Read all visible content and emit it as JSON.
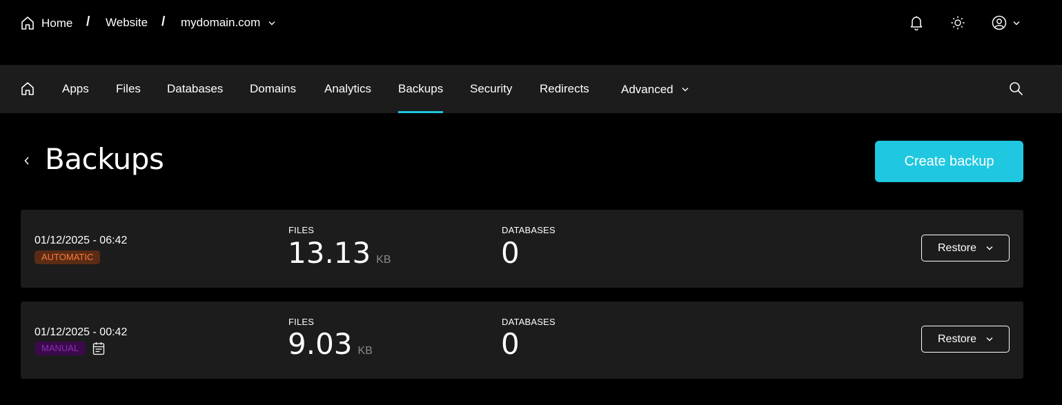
{
  "breadcrumb": {
    "home": "Home",
    "separator": "/",
    "website": "Website",
    "domain": "mydomain.com"
  },
  "top_icons": [
    "bell-icon",
    "sun-icon",
    "account-icon"
  ],
  "nav": {
    "items": [
      {
        "label": "Apps"
      },
      {
        "label": "Files"
      },
      {
        "label": "Databases"
      },
      {
        "label": "Domains"
      },
      {
        "label": "Analytics"
      },
      {
        "label": "Backups",
        "active": true
      },
      {
        "label": "Security"
      },
      {
        "label": "Redirects"
      },
      {
        "label": "Advanced"
      }
    ]
  },
  "page": {
    "title": "Backups",
    "create_button": "Create backup"
  },
  "colors": {
    "accent": "#1fc8e0",
    "background": "#000000",
    "panel": "#1c1c1c",
    "badge_automatic": "#ff7a3a",
    "badge_manual": "#8b2fb8"
  },
  "backups": [
    {
      "date": "01/12/2025 - 06:42",
      "type": "AUTOMATIC",
      "files_label": "FILES",
      "files_value": "13.13",
      "files_unit": "KB",
      "databases_label": "DATABASES",
      "databases_value": "0",
      "restore_label": "Restore"
    },
    {
      "date": "01/12/2025 - 00:42",
      "type": "MANUAL",
      "files_label": "FILES",
      "files_value": "9.03",
      "files_unit": "KB",
      "databases_label": "DATABASES",
      "databases_value": "0",
      "restore_label": "Restore"
    }
  ]
}
